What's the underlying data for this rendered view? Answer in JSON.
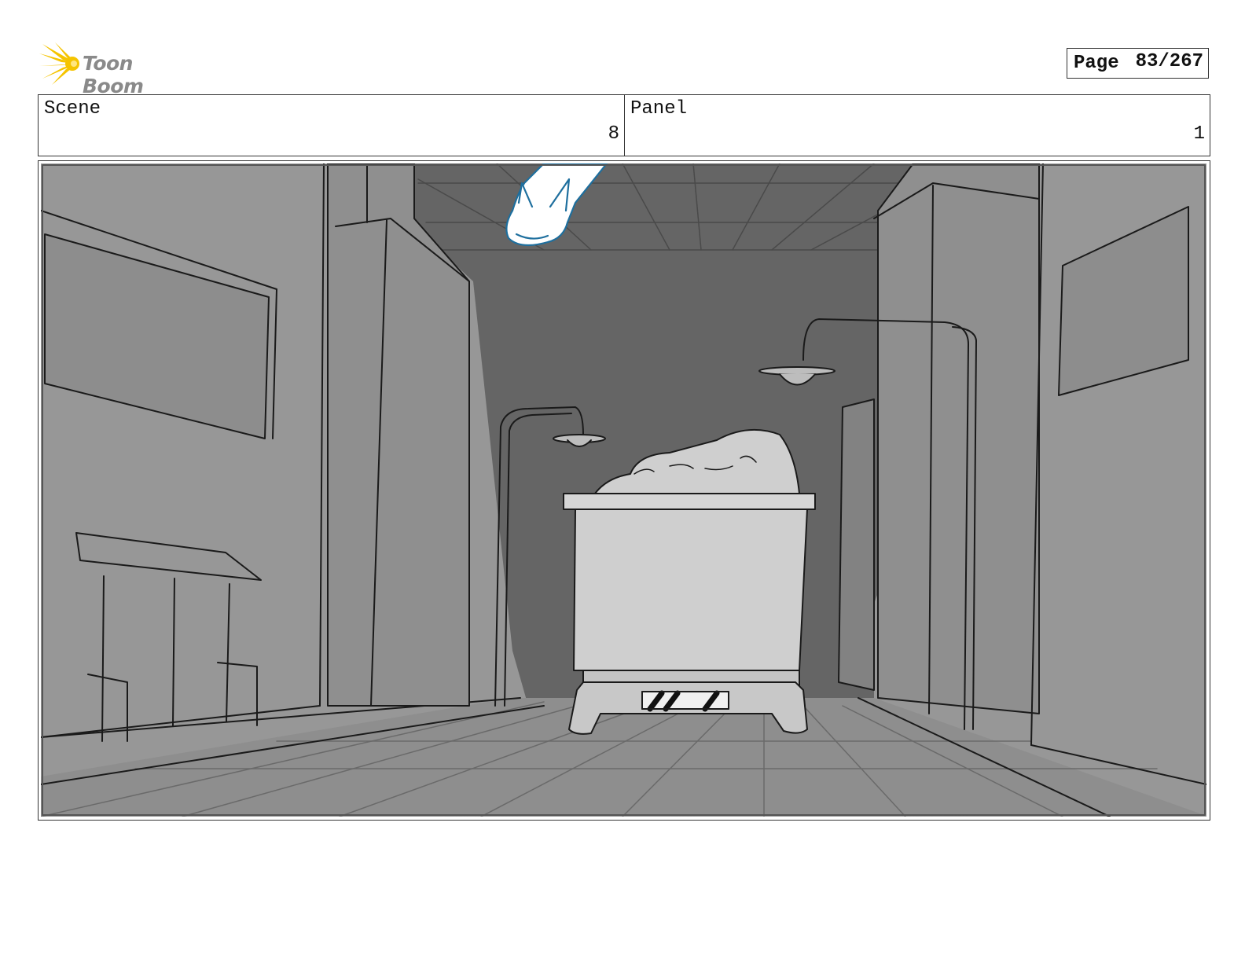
{
  "header": {
    "logo_text": "Toon Boom",
    "page_label": "Page",
    "page_value": "83/267"
  },
  "info": {
    "scene_label": "Scene",
    "scene_value": "8",
    "panel_label": "Panel",
    "panel_value": "1"
  },
  "colors": {
    "logo_yellow": "#f5c400",
    "panel_gray": "#979797",
    "back_wall": "#656565",
    "cart_light": "#cfcfcf",
    "character_outline": "#1e6f9e"
  }
}
